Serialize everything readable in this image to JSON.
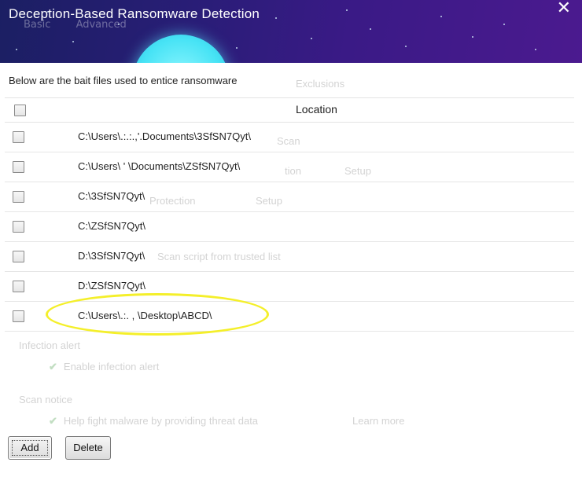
{
  "window": {
    "title": "Deception-Based Ransomware Detection",
    "close_glyph": "✕"
  },
  "background_tabs": [
    "Basic",
    "Advanced"
  ],
  "background_ghost": [
    "Exclusions",
    "Scan",
    "tion",
    "Setup",
    "Protection",
    "Setup",
    "Scan script from trusted list",
    "Infection alert",
    "Enable infection alert",
    "Scan notice",
    "Help fight malware by providing threat data",
    "Learn more"
  ],
  "subtitle": "Below are the bait files used to entice ransomware",
  "table": {
    "header": {
      "location_label": "Location"
    },
    "rows": [
      {
        "path": "C:\\Users\\.:.:.,'.Documents\\3SfSN7Qyt\\",
        "checked": false
      },
      {
        "path": "C:\\Users\\  '   \\Documents\\ZSfSN7Qyt\\",
        "checked": false
      },
      {
        "path": "C:\\3SfSN7Qyt\\",
        "checked": false
      },
      {
        "path": "C:\\ZSfSN7Qyt\\",
        "checked": false
      },
      {
        "path": "D:\\3SfSN7Qyt\\",
        "checked": false
      },
      {
        "path": "D:\\ZSfSN7Qyt\\",
        "checked": false
      },
      {
        "path": "C:\\Users\\.:.   , \\Desktop\\ABCD\\",
        "checked": false
      }
    ]
  },
  "buttons": {
    "add": "Add",
    "delete": "Delete"
  },
  "colors": {
    "highlight": "#f4ef2a",
    "header_start": "#1b1f63",
    "header_end": "#4b1a8f",
    "moon": "#47e3f5"
  }
}
